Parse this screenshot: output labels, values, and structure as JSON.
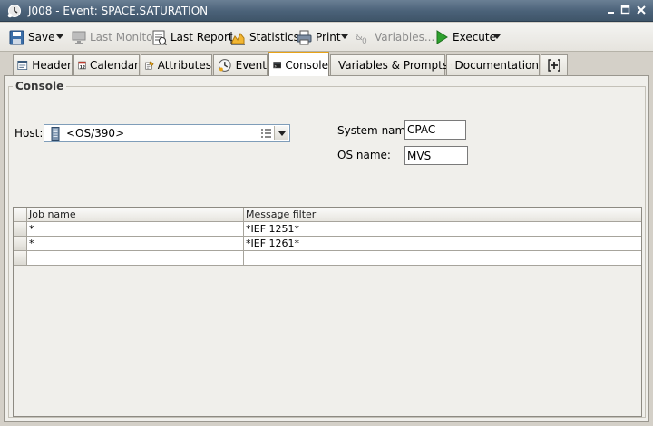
{
  "window": {
    "title": "J008 - Event: SPACE.SATURATION"
  },
  "toolbar": {
    "save_label": "Save",
    "last_monitor_label": "Last Monitor",
    "last_report_label": "Last Report",
    "statistics_label": "Statistics",
    "print_label": "Print",
    "variables_label": "Variables...",
    "execute_label": "Execute"
  },
  "tabs": [
    {
      "label": "Header",
      "icon": "header-icon"
    },
    {
      "label": "Calendar",
      "icon": "calendar-icon"
    },
    {
      "label": "Attributes",
      "icon": "attributes-icon"
    },
    {
      "label": "Event",
      "icon": "event-icon"
    },
    {
      "label": "Console",
      "icon": "console-icon",
      "active": true
    },
    {
      "label": "Variables & Prompts",
      "icon": "variables-icon"
    },
    {
      "label": "Documentation",
      "icon": "documentation-icon"
    }
  ],
  "calendar_icon_text": "12",
  "console": {
    "group_title": "Console",
    "host_label": "Host:",
    "host_value": "<OS/390>",
    "system_name_label": "System name:",
    "system_name_value": "CPAC",
    "os_name_label": "OS name:",
    "os_name_value": "MVS",
    "table": {
      "columns": [
        "Job name",
        "Message filter"
      ],
      "rows": [
        {
          "job_name": "*",
          "message_filter": "*IEF 1251*"
        },
        {
          "job_name": "*",
          "message_filter": "*IEF 1261*"
        },
        {
          "job_name": "",
          "message_filter": ""
        }
      ]
    }
  },
  "colors": {
    "titlebar": "#4a6178",
    "execute_green": "#2ea12e",
    "active_tab_accent": "#e8a317"
  }
}
